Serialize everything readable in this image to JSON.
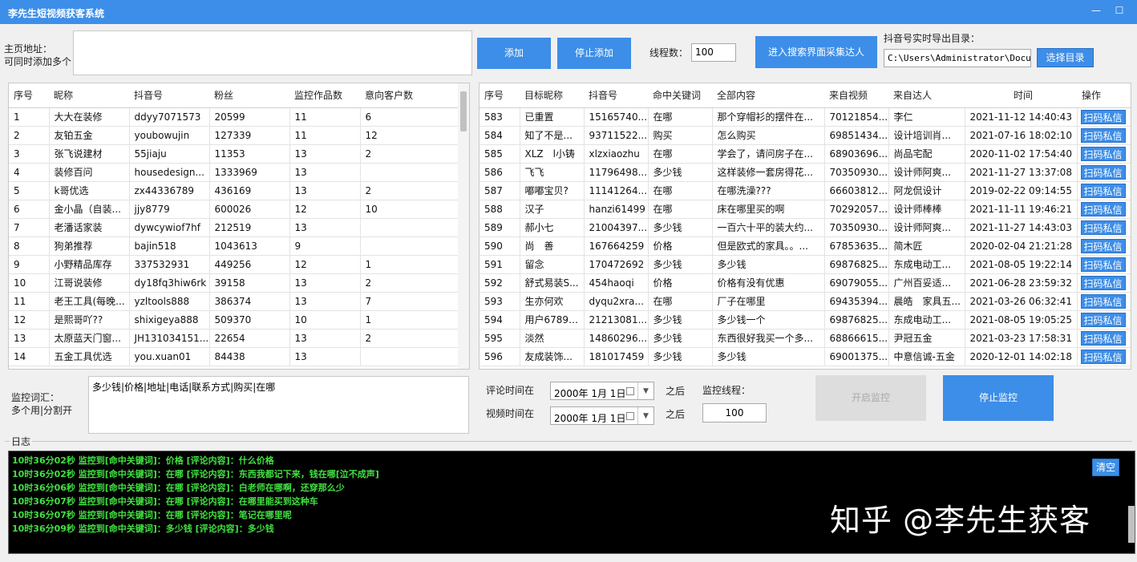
{
  "window": {
    "title": "李先生短视频获客系统",
    "minimize": "—",
    "maximize": "☐"
  },
  "homepage": {
    "label1": "主页地址：",
    "label2": "可同时添加多个",
    "value": ""
  },
  "buttons": {
    "add": "添加",
    "stop_add": "停止添加",
    "search_collect": "进入搜索界面采集达人",
    "choose_dir": "选择目录",
    "start_monitor": "开启监控",
    "stop_monitor": "停止监控",
    "clear": "清空"
  },
  "threads": {
    "label": "线程数：",
    "value": "100"
  },
  "export": {
    "label": "抖音号实时导出目录：",
    "path": "C:\\Users\\Administrator\\Documen"
  },
  "left_table": {
    "headers": [
      "序号",
      "昵称",
      "抖音号",
      "粉丝",
      "监控作品数",
      "意向客户数"
    ],
    "rows": [
      [
        "1",
        "大大在装修",
        "ddyy7071573",
        "20599",
        "11",
        "6"
      ],
      [
        "2",
        "友铂五金",
        "youbowujin",
        "127339",
        "11",
        "12"
      ],
      [
        "3",
        "张飞说建材",
        "55jiaju",
        "11353",
        "13",
        "2"
      ],
      [
        "4",
        "装修百问",
        "housedesign...",
        "1333969",
        "13",
        ""
      ],
      [
        "5",
        "k哥优选",
        "zx44336789",
        "436169",
        "13",
        "2"
      ],
      [
        "6",
        "金小晶（自装...",
        "jjy8779",
        "600026",
        "12",
        "10"
      ],
      [
        "7",
        "老潘话家装",
        "dywcywiof7hf",
        "212519",
        "13",
        ""
      ],
      [
        "8",
        "狗弟推荐",
        "bajin518",
        "1043613",
        "9",
        ""
      ],
      [
        "9",
        "小野精品库存",
        "337532931",
        "449256",
        "12",
        "1"
      ],
      [
        "10",
        "江哥说装修",
        "dy18fq3hiw6rk",
        "39158",
        "13",
        "2"
      ],
      [
        "11",
        "老王工具(每晚...",
        "yzltools888",
        "386374",
        "13",
        "7"
      ],
      [
        "12",
        "是熙哥吖??",
        "shixigeya888",
        "509370",
        "10",
        "1"
      ],
      [
        "13",
        "太原蓝天门窗...",
        "JH131034151...",
        "22654",
        "13",
        "2"
      ],
      [
        "14",
        "五金工具优选",
        "you.xuan01",
        "84438",
        "13",
        ""
      ]
    ]
  },
  "right_table": {
    "headers": [
      "序号",
      "目标昵称",
      "抖音号",
      "命中关键词",
      "全部内容",
      "来自视频",
      "来自达人",
      "时间",
      "操作"
    ],
    "action_label": "扫码私信",
    "rows": [
      [
        "583",
        "已重置",
        "15165740...",
        "在哪",
        "那个穿帽衫的摆件在...",
        "70121854...",
        "李仁",
        "2021-11-12 14:40:43"
      ],
      [
        "584",
        "知了不是...",
        "93711522...",
        "购买",
        "怎么购买",
        "69851434...",
        "设计培训肖...",
        "2021-07-16 18:02:10"
      ],
      [
        "585",
        "XLZ　l小铸",
        "xlzxiaozhu",
        "在哪",
        "学会了，请问房子在...",
        "68903696...",
        "尚品宅配",
        "2020-11-02 17:54:40"
      ],
      [
        "586",
        "飞飞",
        "11796498...",
        "多少钱",
        "这样装修一套房得花...",
        "70350930...",
        "设计师阿爽...",
        "2021-11-27 13:37:08"
      ],
      [
        "587",
        "嘟嘟宝贝?",
        "11141264...",
        "在哪",
        "在哪洗澡???",
        "66603812...",
        "阿龙侃设计",
        "2019-02-22 09:14:55"
      ],
      [
        "588",
        "汉子",
        "hanzi61499",
        "在哪",
        "床在哪里买的啊",
        "70292057...",
        "设计师棒棒",
        "2021-11-11 19:46:21"
      ],
      [
        "589",
        "郝小七",
        "21004397...",
        "多少钱",
        "一百六十平的装大约...",
        "70350930...",
        "设计师阿爽...",
        "2021-11-27 14:43:03"
      ],
      [
        "590",
        "尚　善",
        "167664259",
        "价格",
        "但是欧式的家具。。...",
        "67853635...",
        "简木匠",
        "2020-02-04 21:21:28"
      ],
      [
        "591",
        "留念",
        "170472692",
        "多少钱",
        "多少钱",
        "69876825...",
        "东成电动工...",
        "2021-08-05 19:22:14"
      ],
      [
        "592",
        "舒式易装S...",
        "454haoqi",
        "价格",
        "价格有没有优惠",
        "69079055...",
        "广州百妥适...",
        "2021-06-28 23:59:32"
      ],
      [
        "593",
        "生亦何欢",
        "dyqu2xra...",
        "在哪",
        "厂子在哪里",
        "69435394...",
        "晨皓　家具五...",
        "2021-03-26 06:32:41"
      ],
      [
        "594",
        "用户67895...",
        "21213081...",
        "多少钱",
        "多少钱一个",
        "69876825...",
        "东成电动工...",
        "2021-08-05 19:05:25"
      ],
      [
        "595",
        "淡然",
        "14860296...",
        "多少钱",
        "东西很好我买一个多...",
        "68866615...",
        "尹冠五金",
        "2021-03-23 17:58:31"
      ],
      [
        "596",
        "友成装饰...",
        "181017459",
        "多少钱",
        "多少钱",
        "69001375...",
        "中意信诚-五金",
        "2020-12-01 14:02:18"
      ]
    ]
  },
  "keywords": {
    "label1": "监控词汇：",
    "label2": "多个用|分割开",
    "value": "多少钱|价格|地址|电话|联系方式|购买|在哪"
  },
  "filters": {
    "comment_time_label": "评论时间在",
    "comment_date": "2000年  1月  1日",
    "video_time_label": "视频时间在",
    "video_date": "2000年  1月  1日",
    "after_label": "之后",
    "monitor_threads_label": "监控线程：",
    "monitor_threads_value": "100"
  },
  "log": {
    "label": "日志",
    "lines": [
      "10时36分02秒 监控到[命中关键词]：价格 [评论内容]：什么价格",
      "10时36分02秒 监控到[命中关键词]：在哪 [评论内容]：东西我都记下来，钱在哪[泣不成声]",
      "10时36分06秒 监控到[命中关键词]：在哪 [评论内容]：白老师在哪啊，还穿那么少",
      "10时36分07秒 监控到[命中关键词]：在哪 [评论内容]：在哪里能买到这种车",
      "10时36分07秒 监控到[命中关键词]：在哪 [评论内容]：笔记在哪里呢",
      "10时36分09秒 监控到[命中关键词]：多少钱 [评论内容]：多少钱"
    ]
  },
  "watermark": "知乎 @李先生获客",
  "colors": {
    "accent": "#3d8ee8",
    "log_text": "#41e141",
    "disabled": "#dddddd"
  }
}
